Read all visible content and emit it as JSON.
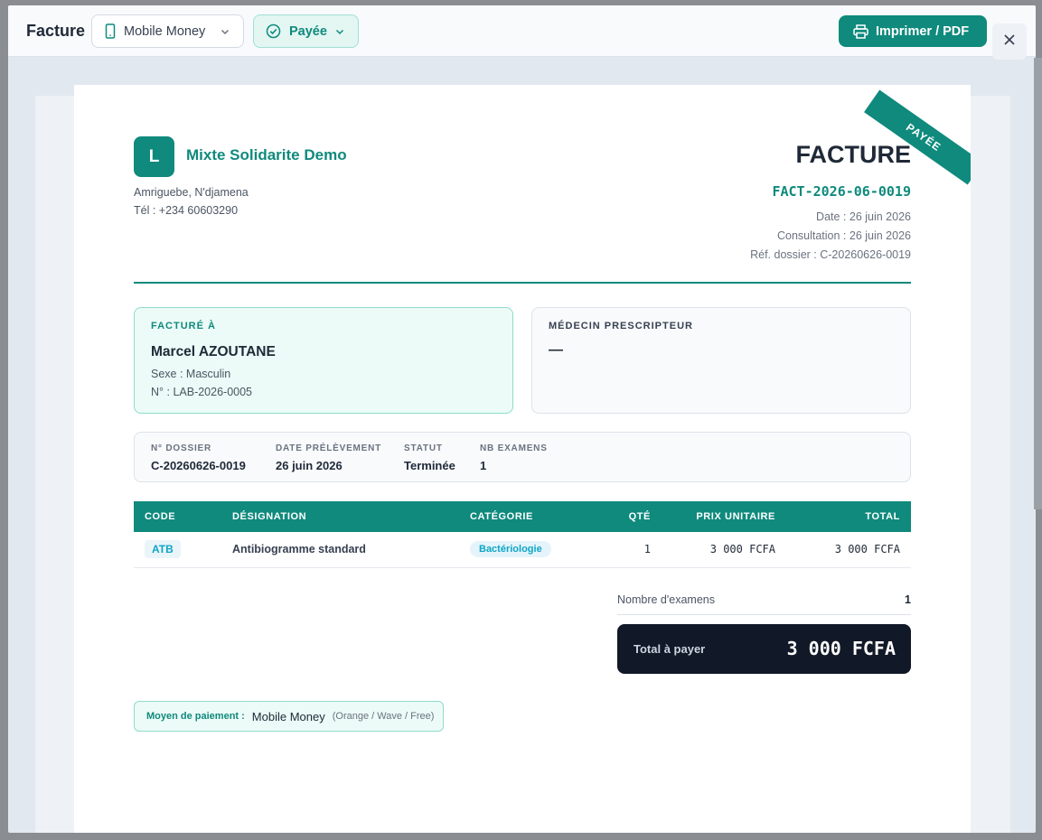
{
  "toolbar": {
    "title": "Facture",
    "payment_method": "Mobile Money",
    "status": "Payée",
    "print_label": "Imprimer / PDF",
    "icons": [
      "phone-icon",
      "check-circle-icon",
      "chevron-down-icon",
      "printer-icon",
      "close-icon"
    ]
  },
  "invoice": {
    "stamp": "PAYÉE",
    "org": {
      "logo_letter": "L",
      "name": "Mixte Solidarite Demo",
      "address": "Amriguebe, N'djamena",
      "phone": "Tél : +234 60603290"
    },
    "heading": "FACTURE",
    "number": "FACT-2026-06-0019",
    "date": "Date : 26 juin 2026",
    "consultation": "Consultation : 26 juin 2026",
    "dossier_ref": "Réf. dossier : C-20260626-0019"
  },
  "billed_to": {
    "label": "FACTURÉ À",
    "name": "Marcel AZOUTANE",
    "sex": "Sexe : Masculin",
    "number": "N° : LAB-2026-0005"
  },
  "doctor": {
    "label": "MÉDECIN PRESCRIPTEUR",
    "value": "—"
  },
  "info": [
    {
      "label": "N° DOSSIER",
      "value": "C-20260626-0019"
    },
    {
      "label": "DATE PRÉLÈVEMENT",
      "value": "26 juin 2026"
    },
    {
      "label": "STATUT",
      "value": "Terminée"
    },
    {
      "label": "NB EXAMENS",
      "value": "1"
    }
  ],
  "table": {
    "headers": [
      "CODE",
      "DÉSIGNATION",
      "CATÉGORIE",
      "QTÉ",
      "PRIX UNITAIRE",
      "TOTAL"
    ],
    "rows": [
      {
        "code": "ATB",
        "designation": "Antibiogramme standard",
        "category": "Bactériologie",
        "qty": "1",
        "unit_price": "3 000 FCFA",
        "total": "3 000 FCFA"
      }
    ]
  },
  "summary": {
    "exam_count_label": "Nombre d'examens",
    "exam_count": "1",
    "total_label": "Total à payer",
    "total": "3 000 FCFA"
  },
  "payment": {
    "label": "Moyen de paiement :",
    "value": "Mobile Money",
    "note": "(Orange / Wave / Free)"
  },
  "colors": {
    "accent": "#0f8a7d",
    "dark": "#111827",
    "chip_blue": "#0ea5c6"
  }
}
